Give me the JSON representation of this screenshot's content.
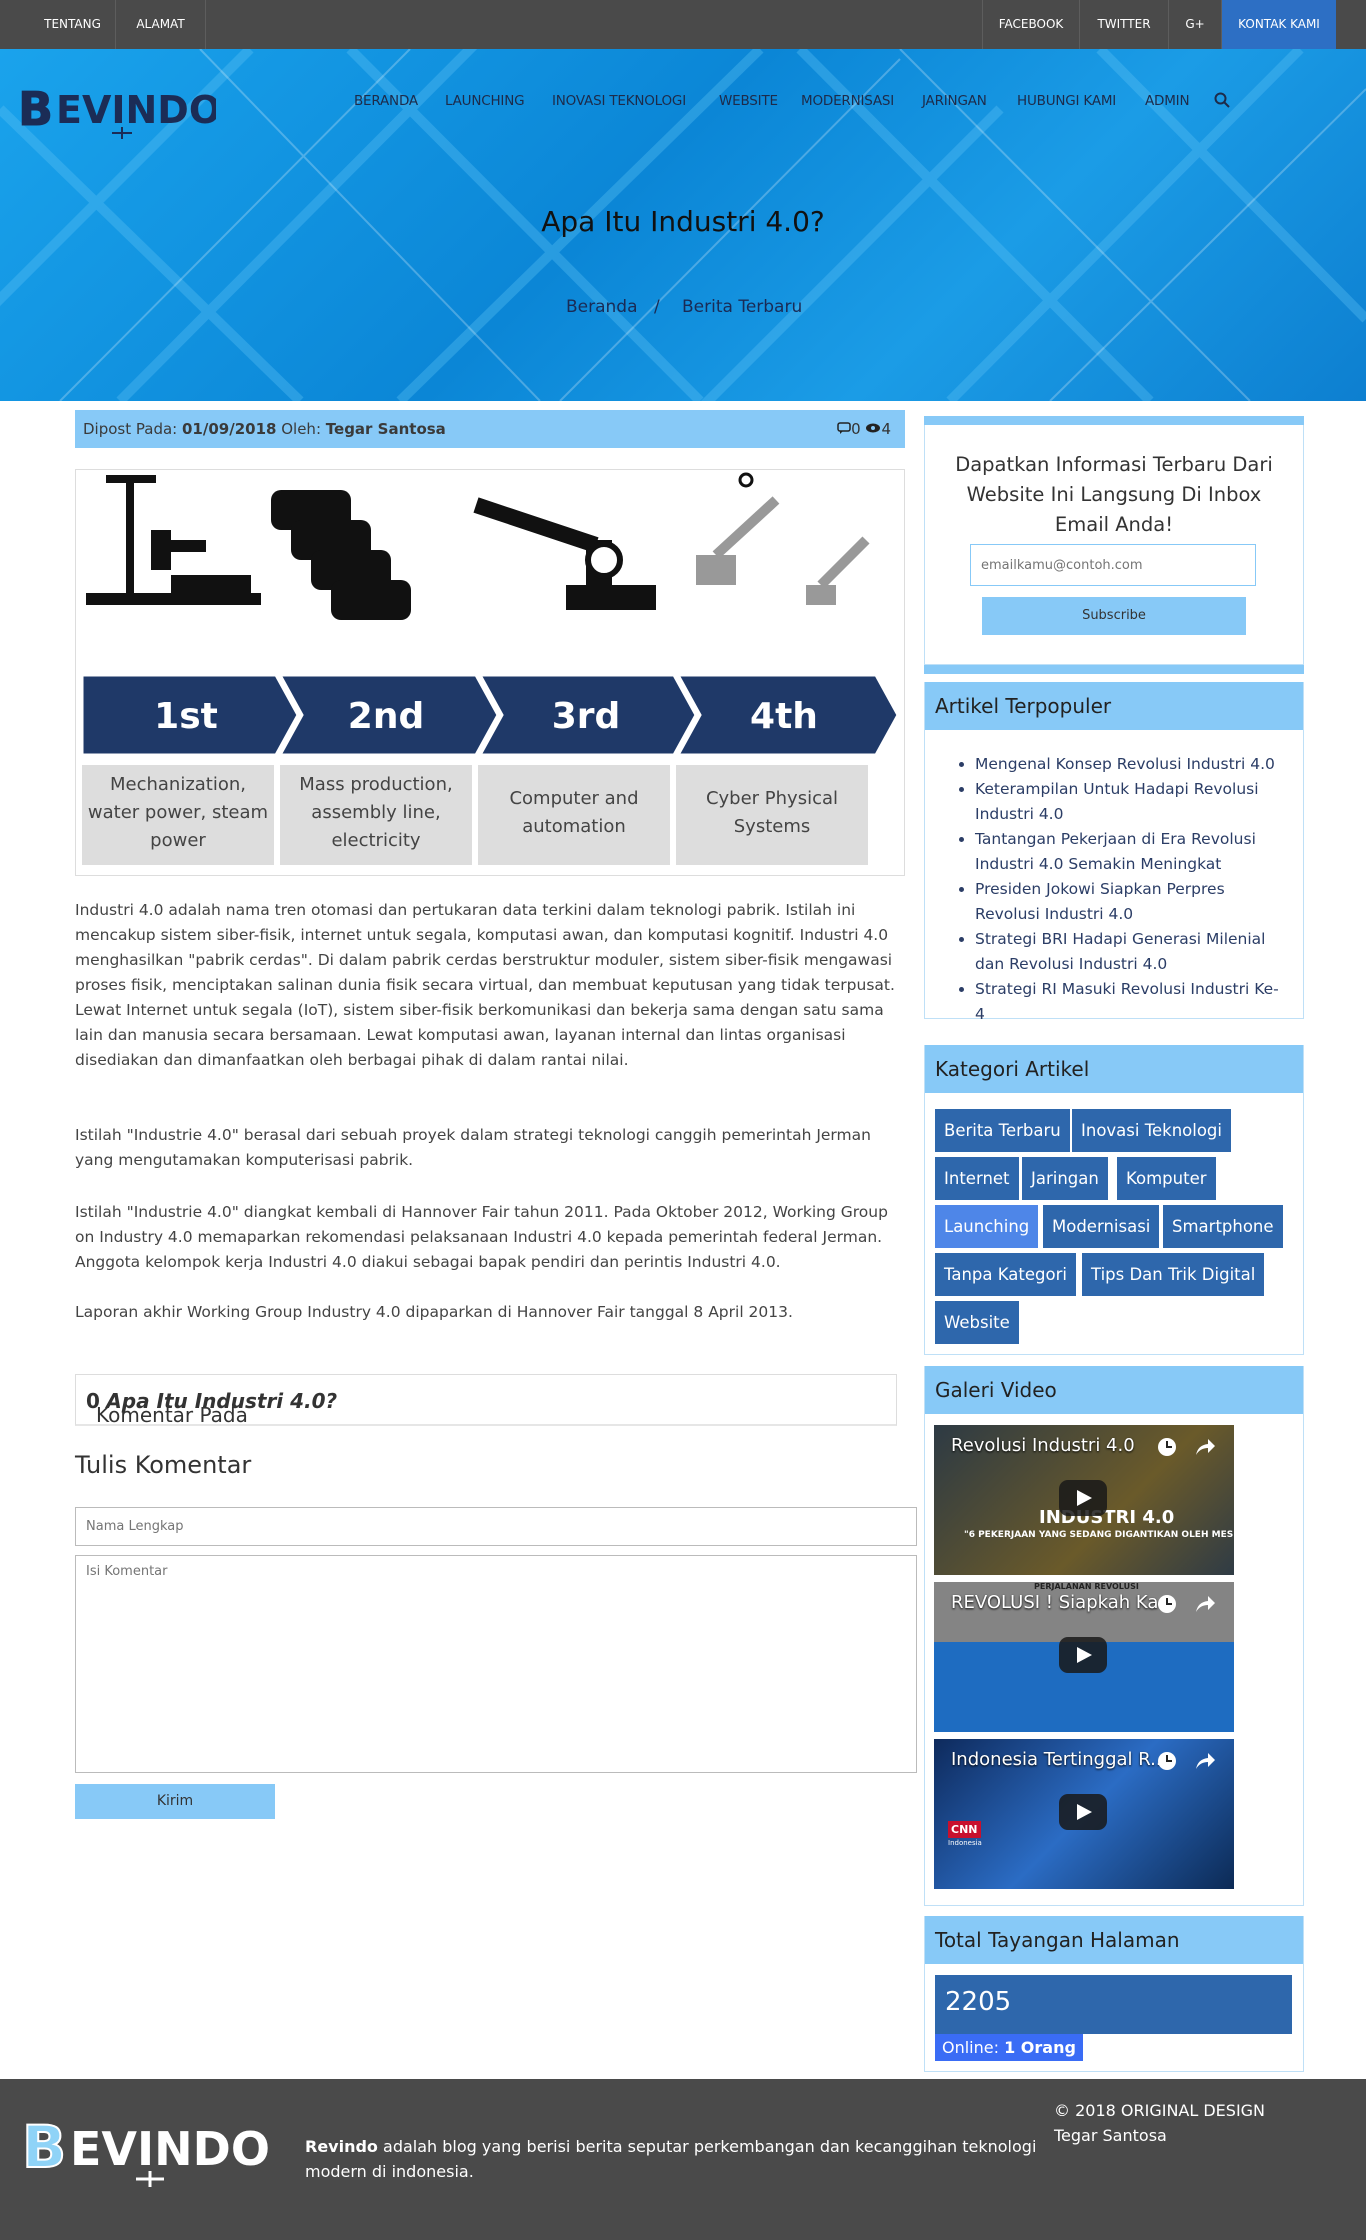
{
  "topbar": {
    "left": [
      "TENTANG",
      "ALAMAT"
    ],
    "right": [
      "FACEBOOK",
      "TWITTER",
      "G+",
      "KONTAK KAMI"
    ]
  },
  "brand": {
    "logo_text": "BEVINDO"
  },
  "nav": [
    "BERANDA",
    "LAUNCHING",
    "INOVASI TEKNOLOGI",
    "WEBSITE",
    "MODERNISASI",
    "JARINGAN",
    "HUBUNGI KAMI",
    "ADMIN"
  ],
  "hero": {
    "title": "Apa Itu Industri 4.0?",
    "crumb_home": "Beranda",
    "crumb_sep": "/",
    "crumb_cat": "Berita Terbaru"
  },
  "post_meta": {
    "posted_label": "Dipost Pada:",
    "date": "01/09/2018",
    "by_label": "Oleh:",
    "author": "Tegar Santosa",
    "comments": "0",
    "views": "4"
  },
  "illustration": {
    "stages": [
      {
        "ordinal": "1st",
        "caption": [
          "Mechanization,",
          "water power, steam",
          "power"
        ]
      },
      {
        "ordinal": "2nd",
        "caption": [
          "Mass production,",
          "assembly line,",
          "electricity"
        ]
      },
      {
        "ordinal": "3rd",
        "caption": [
          "Computer and",
          "automation"
        ]
      },
      {
        "ordinal": "4th",
        "caption": [
          "Cyber Physical",
          "Systems"
        ]
      }
    ]
  },
  "article": {
    "p1": "Industri 4.0 adalah nama tren otomasi dan pertukaran data terkini dalam teknologi pabrik. Istilah ini mencakup sistem siber-fisik, internet untuk segala, komputasi awan, dan komputasi kognitif. Industri 4.0 menghasilkan \"pabrik cerdas\". Di dalam pabrik cerdas berstruktur moduler, sistem siber-fisik mengawasi proses fisik, menciptakan salinan dunia fisik secara virtual, dan membuat keputusan yang tidak terpusat. Lewat Internet untuk segala (IoT), sistem siber-fisik berkomunikasi dan bekerja sama dengan satu sama lain dan manusia secara bersamaan. Lewat komputasi awan, layanan internal dan lintas organisasi disediakan dan dimanfaatkan oleh berbagai pihak di dalam rantai nilai.",
    "p2": "Istilah \"Industrie 4.0\" berasal dari sebuah proyek dalam strategi teknologi canggih pemerintah Jerman yang mengutamakan komputerisasi pabrik.",
    "p3": "Istilah \"Industrie 4.0\" diangkat kembali di Hannover Fair tahun 2011. Pada Oktober 2012, Working Group on Industry 4.0 memaparkan rekomendasi pelaksanaan Industri 4.0 kepada pemerintah federal Jerman. Anggota kelompok kerja Industri 4.0 diakui sebagai bapak pendiri dan perintis Industri 4.0.",
    "p4": "Laporan akhir Working Group Industry 4.0 dipaparkan di Hannover Fair tanggal 8 April 2013."
  },
  "comments": {
    "count": "0",
    "label": "Komentar Pada",
    "post_title": "Apa Itu Industri 4.0?",
    "form_title": "Tulis Komentar",
    "name_placeholder": "Nama Lengkap",
    "body_placeholder": "Isi Komentar",
    "submit": "Kirim"
  },
  "subscribe": {
    "text": "Dapatkan Informasi Terbaru Dari Website Ini Langsung Di Inbox Email Anda!",
    "placeholder": "emailkamu@contoh.com",
    "button": "Subscribe"
  },
  "popular": {
    "title": "Artikel Terpopuler",
    "items": [
      "Mengenal Konsep Revolusi Industri 4.0",
      "Keterampilan Untuk Hadapi Revolusi Industri 4.0",
      "Tantangan Pekerjaan di Era Revolusi Industri 4.0 Semakin Meningkat",
      "Presiden Jokowi Siapkan Perpres Revolusi Industri 4.0",
      "Strategi BRI Hadapi Generasi Milenial dan Revolusi Industri 4.0",
      "Strategi RI Masuki Revolusi Industri Ke-4"
    ]
  },
  "categories": {
    "title": "Kategori Artikel",
    "items": [
      "Berita Terbaru",
      "Inovasi Teknologi",
      "Internet",
      "Jaringan",
      "Komputer",
      "Launching",
      "Modernisasi",
      "Smartphone",
      "Tanpa Kategori",
      "Tips Dan Trik Digital",
      "Website"
    ]
  },
  "videos": {
    "title": "Galeri Video",
    "items": [
      {
        "title": "Revolusi Industri 4.0",
        "overlay": "INDUSTRI 4.0",
        "sub": "\"6 PEKERJAAN YANG SEDANG DIGANTIKAN OLEH MESIN\""
      },
      {
        "title": "REVOLUSI ! Siapkah Ka...",
        "overlay": "PERJALANAN REVOLUSI",
        "sub": ""
      },
      {
        "title": "Indonesia Tertinggal R...",
        "overlay": "CNN",
        "sub": "Indonesia"
      }
    ]
  },
  "pageviews": {
    "title": "Total Tayangan Halaman",
    "count": "2205",
    "online_label": "Online:",
    "online_value": "1 Orang"
  },
  "footer": {
    "brand": "Revindo",
    "desc": "adalah blog yang berisi berita seputar perkembangan dan kecanggihan teknologi modern di indonesia.",
    "copyright": "© 2018 ORIGINAL DESIGN Tegar Santosa"
  },
  "colors": {
    "topbar": "#4a4a4a",
    "hero": "#1296e2",
    "accent": "#87c9f7",
    "tag": "#2e67ac",
    "kontak": "#2d6fc4"
  }
}
